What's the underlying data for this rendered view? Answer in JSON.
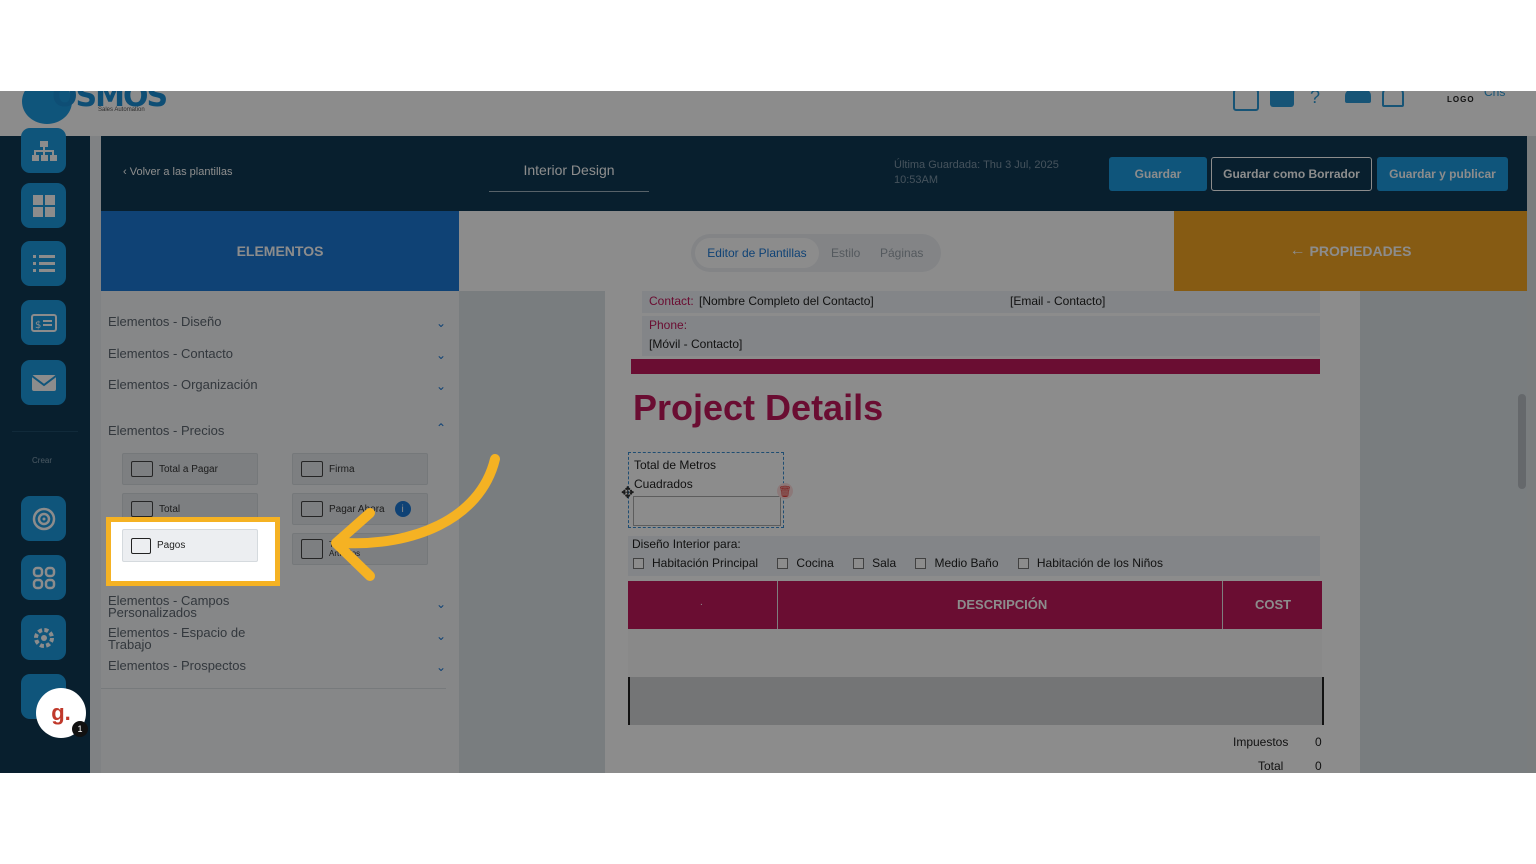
{
  "topbar": {
    "logo_text": "OSMOS",
    "logo_tagline": "Sales Automation",
    "brand_logo_small": "LOGO",
    "user_initials": "Chs"
  },
  "header": {
    "back_label": "Volver a las plantillas",
    "template_name": "Interior Design",
    "last_saved": "Última Guardada: Thu 3 Jul, 2025 10:53AM",
    "save_label": "Guardar",
    "save_draft_label": "Guardar como Borrador",
    "save_publish_label": "Guardar y publicar"
  },
  "rail": {
    "create_label": "Crear"
  },
  "panels": {
    "elements_title": "ELEMENTOS",
    "properties_title": "PROPIEDADES",
    "tabs": [
      "Editor de Plantillas",
      "Estilo",
      "Páginas"
    ]
  },
  "sidebar": {
    "sections": [
      "Elementos - Diseño",
      "Elementos - Contacto",
      "Elementos - Organización",
      "Elementos - Precios",
      "Elementos - Campos Personalizados",
      "Elementos - Espacio de Trabajo",
      "Elementos - Prospectos"
    ],
    "price_items": {
      "total_pagar": "Total a Pagar",
      "firma": "Firma",
      "total": "Total",
      "pagar_ahora": "Pagar Ahora",
      "pagos": "Pagos",
      "tabla": "Tabla de Artículos"
    }
  },
  "document": {
    "contact_label": "Contact:",
    "contact_value": "[Nombre Completo del Contacto]",
    "email_value": "[Email - Contacto]",
    "phone_label": "Phone:",
    "phone_value": "[Móvil - Contacto]",
    "section_title": "Project Details",
    "sqm_label": "Total de Metros Cuadrados",
    "design_for_label": "Diseño Interior para:",
    "options": [
      "Habitación Principal",
      "Cocina",
      "Sala",
      "Medio Baño",
      "Habitación de los Niños"
    ],
    "table_headers": [
      ".",
      "DESCRIPCIÓN",
      "COST"
    ],
    "tax_label": "Impuestos",
    "tax_value": "0",
    "total_label": "Total",
    "total_value": "0"
  },
  "colors": {
    "navy": "#0f3a55",
    "blue": "#1d79d6",
    "orange": "#f5a623",
    "magenta": "#c2185b"
  },
  "avatar": {
    "letter": "g.",
    "badge": "1"
  }
}
